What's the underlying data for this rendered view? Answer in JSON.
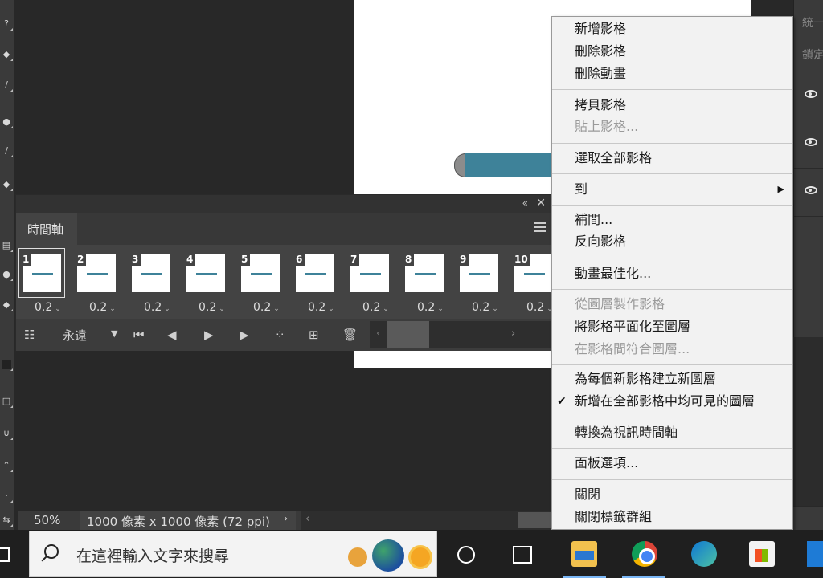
{
  "right_panel": {
    "labels": [
      "統一",
      "鎖定"
    ],
    "layer_rows": 3
  },
  "timeline": {
    "tab_label": "時間軸",
    "collapse_icon": "«",
    "close_icon": "✕",
    "frames": [
      {
        "number": "1",
        "delay": "0.2",
        "selected": true
      },
      {
        "number": "2",
        "delay": "0.2",
        "selected": false
      },
      {
        "number": "3",
        "delay": "0.2",
        "selected": false
      },
      {
        "number": "4",
        "delay": "0.2",
        "selected": false
      },
      {
        "number": "5",
        "delay": "0.2",
        "selected": false
      },
      {
        "number": "6",
        "delay": "0.2",
        "selected": false
      },
      {
        "number": "7",
        "delay": "0.2",
        "selected": false
      },
      {
        "number": "8",
        "delay": "0.2",
        "selected": false
      },
      {
        "number": "9",
        "delay": "0.2",
        "selected": false
      },
      {
        "number": "10",
        "delay": "0.2",
        "selected": false
      }
    ],
    "loop_option": "永遠",
    "controls": [
      "convert-icon",
      "first-frame-icon",
      "prev-frame-icon",
      "play-icon",
      "next-frame-icon",
      "tween-icon",
      "duplicate-frame-icon",
      "delete-frame-icon"
    ]
  },
  "status": {
    "zoom": "50%",
    "doc_info": "1000 像素 x 1000 像素 (72 ppi)"
  },
  "menu": {
    "items": [
      {
        "label": "新增影格",
        "disabled": false
      },
      {
        "label": "刪除影格",
        "disabled": false
      },
      {
        "label": "刪除動畫",
        "disabled": false
      },
      {
        "label": "拷貝影格",
        "disabled": false
      },
      {
        "label": "貼上影格...",
        "disabled": true
      },
      {
        "label": "選取全部影格",
        "disabled": false
      },
      {
        "label": "到",
        "disabled": false,
        "submenu": true
      },
      {
        "label": "補間...",
        "disabled": false
      },
      {
        "label": "反向影格",
        "disabled": false
      },
      {
        "label": "動畫最佳化...",
        "disabled": false
      },
      {
        "label": "從圖層製作影格",
        "disabled": true
      },
      {
        "label": "將影格平面化至圖層",
        "disabled": false
      },
      {
        "label": "在影格間符合圖層...",
        "disabled": true
      },
      {
        "label": "為每個新影格建立新圖層",
        "disabled": false
      },
      {
        "label": "新增在全部影格中均可見的圖層",
        "disabled": false,
        "checked": true
      },
      {
        "label": "轉換為視訊時間軸",
        "disabled": false
      },
      {
        "label": "面板選項...",
        "disabled": false
      },
      {
        "label": "關閉",
        "disabled": false
      },
      {
        "label": "關閉標籤群組",
        "disabled": false
      }
    ]
  },
  "taskbar": {
    "search_placeholder": "在這裡輸入文字來搜尋",
    "apps": [
      "task-view-icon",
      "widgets-icon",
      "file-explorer-icon",
      "chrome-icon",
      "edge-icon",
      "store-icon",
      "mail-icon"
    ]
  },
  "colors": {
    "accent_bar": "#3e8299",
    "menu_bg": "#f2f2f2",
    "panel_bg": "#434343"
  }
}
